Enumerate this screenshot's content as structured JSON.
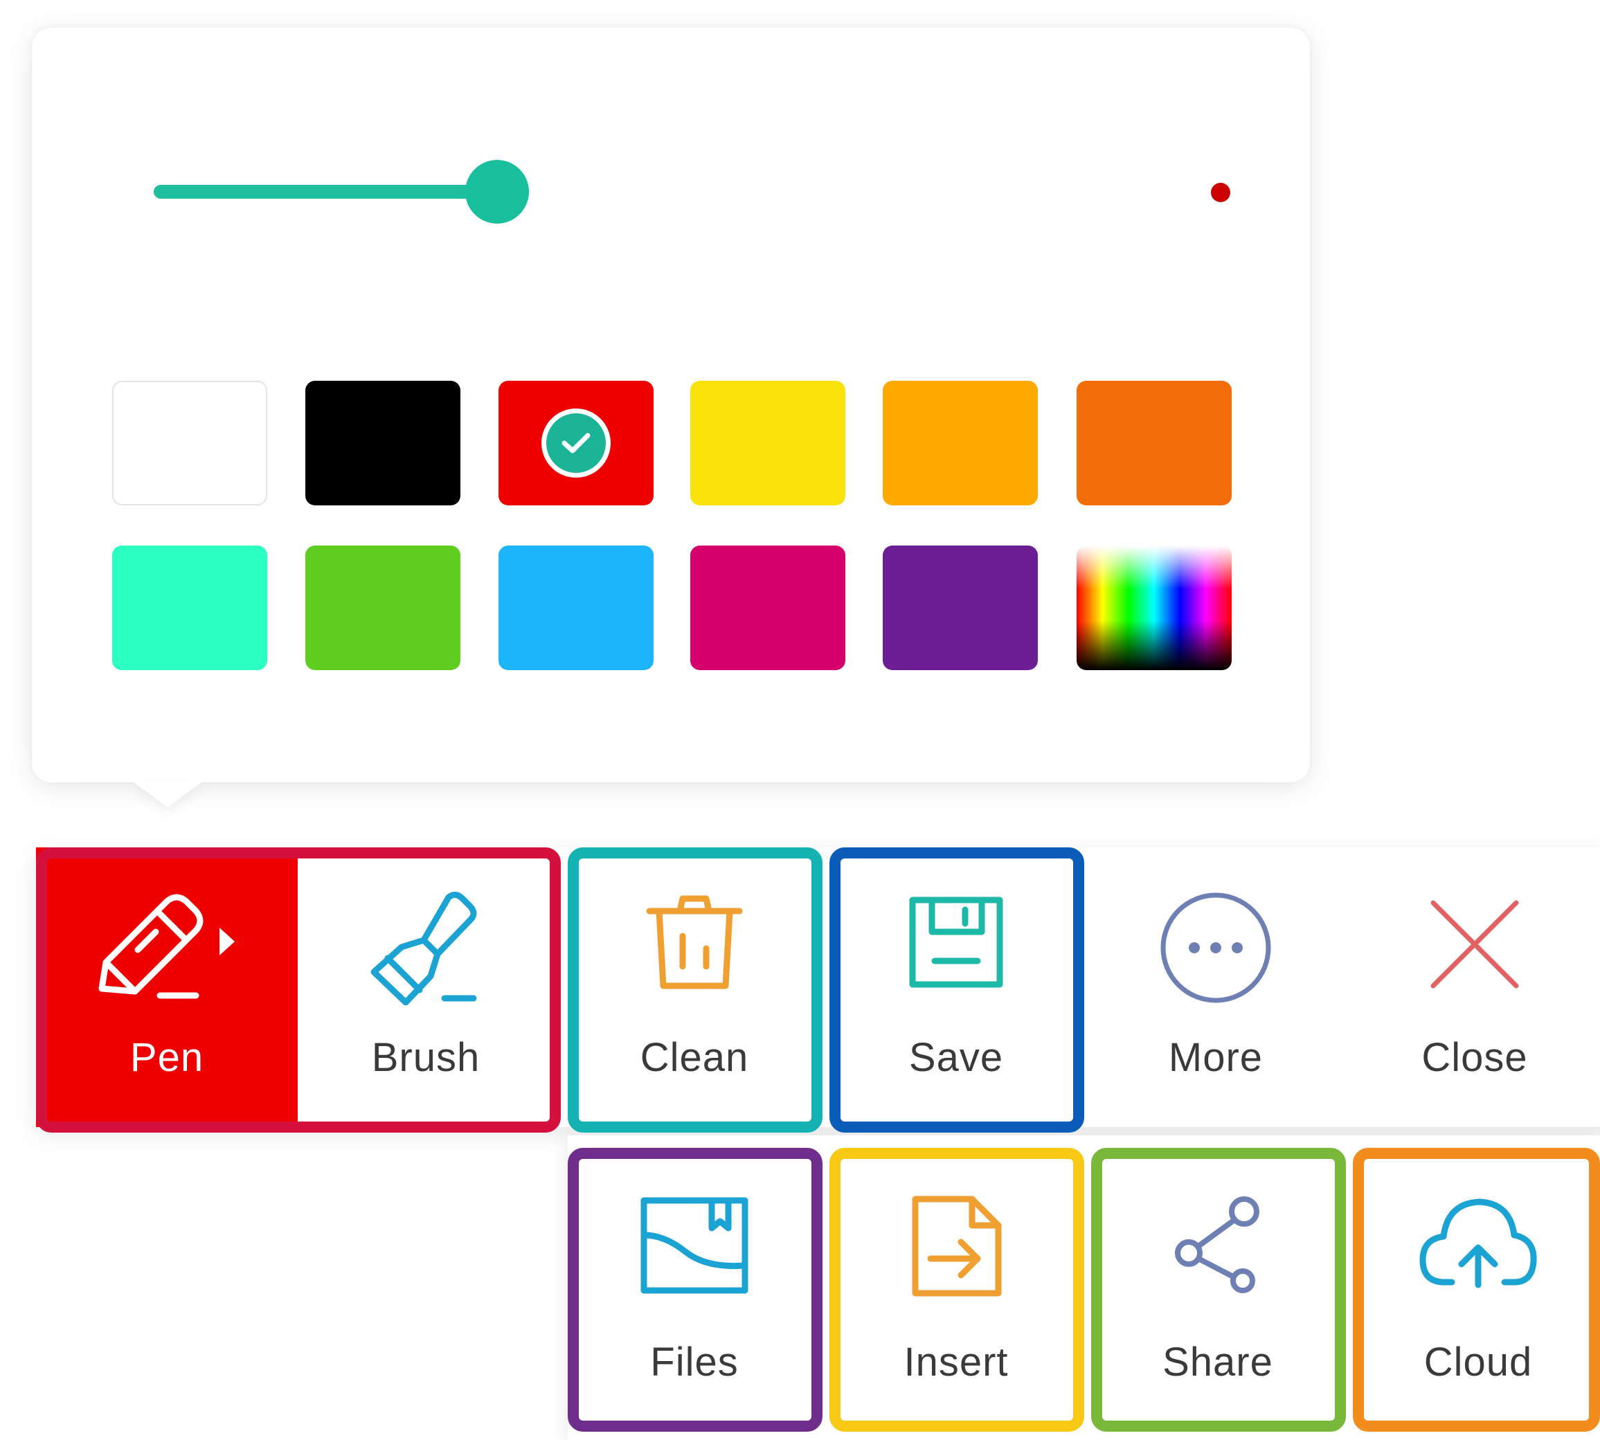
{
  "palette": {
    "brush_size": 0.72,
    "slider_color": "#17bf9d",
    "size_preview_color": "#cc0000",
    "swatches": [
      {
        "name": "white",
        "color": "#ffffff"
      },
      {
        "name": "black",
        "color": "#000000"
      },
      {
        "name": "red",
        "color": "#ee0000",
        "selected": true
      },
      {
        "name": "yellow",
        "color": "#fae20d"
      },
      {
        "name": "amber",
        "color": "#fea800"
      },
      {
        "name": "orange",
        "color": "#f36c0c"
      },
      {
        "name": "mint",
        "color": "#2bffc2"
      },
      {
        "name": "green",
        "color": "#5fcd1e"
      },
      {
        "name": "blue",
        "color": "#1cb5fc"
      },
      {
        "name": "magenta",
        "color": "#d6006d"
      },
      {
        "name": "purple",
        "color": "#6c1f95"
      },
      {
        "name": "custom-spectrum",
        "color": "gradient"
      }
    ]
  },
  "toolbar": {
    "pen": "Pen",
    "brush": "Brush",
    "clean": "Clean",
    "save": "Save",
    "more": "More",
    "close": "Close"
  },
  "more_menu": {
    "files": "Files",
    "insert": "Insert",
    "share": "Share",
    "cloud": "Cloud"
  },
  "colors": {
    "pen_active_bg": "#ee0000",
    "frame_pen": "#d4103c",
    "frame_clean": "#14b2b2",
    "frame_save": "#0a5cb8",
    "frame_files": "#6f2d8c",
    "frame_insert": "#f7c915",
    "frame_share": "#7ab83c",
    "frame_cloud": "#f28c1c"
  }
}
